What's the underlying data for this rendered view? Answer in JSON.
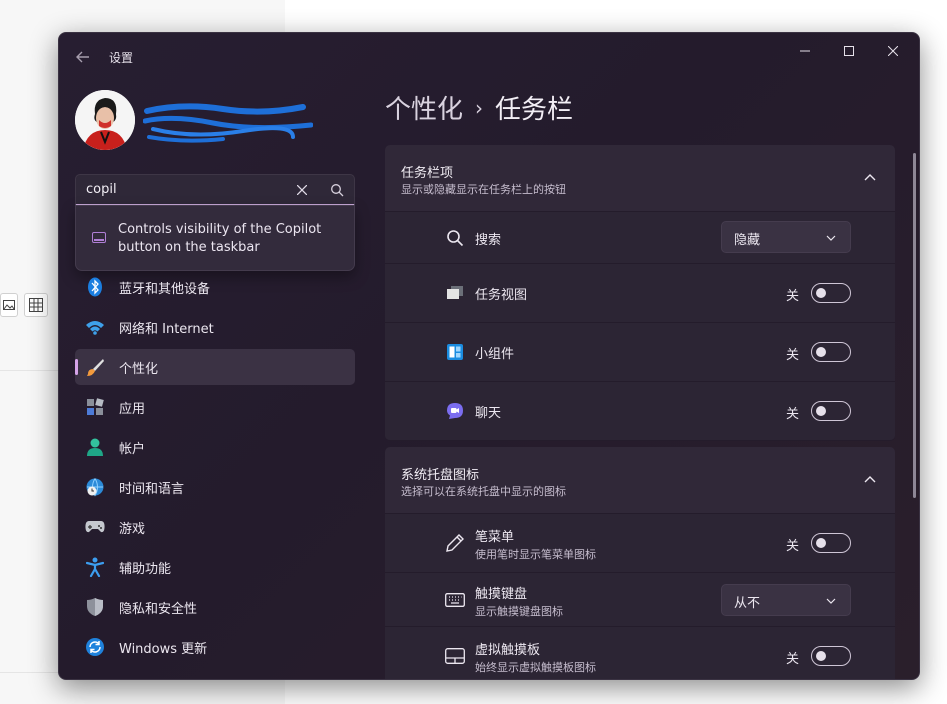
{
  "window": {
    "title": "设置"
  },
  "search": {
    "value": "copil",
    "suggestion": "Controls visibility of the Copilot button on the taskbar"
  },
  "nav": {
    "items": [
      {
        "label": "蓝牙和其他设备",
        "icon": "bluetooth-icon"
      },
      {
        "label": "网络和 Internet",
        "icon": "wifi-icon"
      },
      {
        "label": "个性化",
        "icon": "brush-icon",
        "active": true
      },
      {
        "label": "应用",
        "icon": "apps-icon"
      },
      {
        "label": "帐户",
        "icon": "account-icon"
      },
      {
        "label": "时间和语言",
        "icon": "globe-clock-icon"
      },
      {
        "label": "游戏",
        "icon": "gamepad-icon"
      },
      {
        "label": "辅助功能",
        "icon": "accessibility-icon"
      },
      {
        "label": "隐私和安全性",
        "icon": "shield-icon"
      },
      {
        "label": "Windows 更新",
        "icon": "update-icon"
      }
    ]
  },
  "breadcrumb": {
    "parent": "个性化",
    "separator": "›",
    "current": "任务栏"
  },
  "sections": [
    {
      "title": "任务栏项",
      "subtitle": "显示或隐藏显示在任务栏上的按钮",
      "rows": [
        {
          "label": "搜索",
          "icon": "search-icon",
          "control": "dropdown",
          "value": "隐藏"
        },
        {
          "label": "任务视图",
          "icon": "task-view-icon",
          "control": "toggle",
          "value": "关"
        },
        {
          "label": "小组件",
          "icon": "widgets-icon",
          "control": "toggle",
          "value": "关"
        },
        {
          "label": "聊天",
          "icon": "chat-icon",
          "control": "toggle",
          "value": "关"
        }
      ]
    },
    {
      "title": "系统托盘图标",
      "subtitle": "选择可以在系统托盘中显示的图标",
      "rows": [
        {
          "label": "笔菜单",
          "sub": "使用笔时显示笔菜单图标",
          "icon": "pen-icon",
          "control": "toggle",
          "value": "关"
        },
        {
          "label": "触摸键盘",
          "sub": "显示触摸键盘图标",
          "icon": "keyboard-icon",
          "control": "dropdown",
          "value": "从不"
        },
        {
          "label": "虚拟触摸板",
          "sub": "始终显示虚拟触摸板图标",
          "icon": "touchpad-icon",
          "control": "toggle",
          "value": "关"
        }
      ]
    }
  ],
  "colors": {
    "accent": "#d5a3e8",
    "window_bg": "#271e31",
    "card_bg": "#2c2534"
  }
}
